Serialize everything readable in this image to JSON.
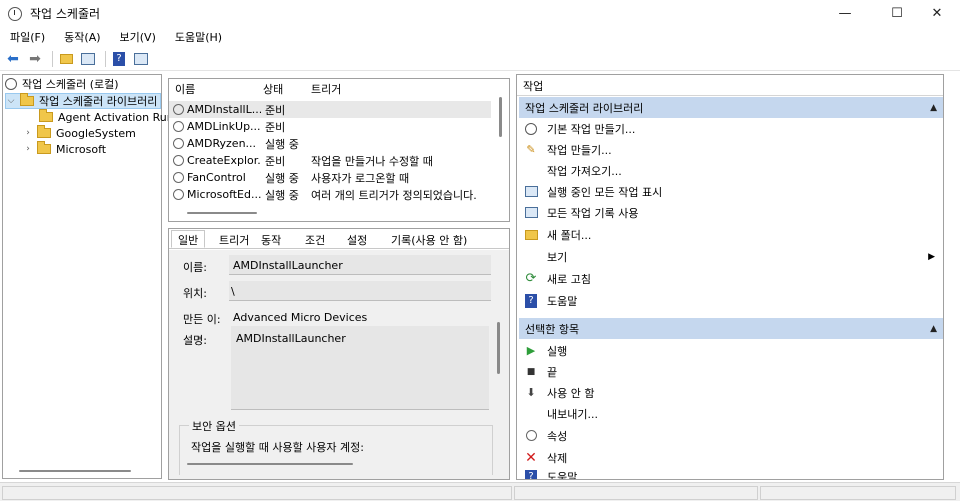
{
  "window": {
    "title": "작업 스케줄러"
  },
  "menu": [
    "파일(F)",
    "동작(A)",
    "보기(V)",
    "도움말(H)"
  ],
  "tree": {
    "root": "작업 스케줄러 (로컬)",
    "library": "작업 스케줄러 라이브러리",
    "children": [
      "Agent Activation Runtime",
      "GoogleSystem",
      "Microsoft"
    ]
  },
  "list": {
    "columns": [
      "이름",
      "상태",
      "트리거"
    ],
    "rows": [
      {
        "name": "AMDInstallL...",
        "status": "준비",
        "trigger": ""
      },
      {
        "name": "AMDLinkUp...",
        "status": "준비",
        "trigger": ""
      },
      {
        "name": "AMDRyzen...",
        "status": "실행 중",
        "trigger": ""
      },
      {
        "name": "CreateExplor...",
        "status": "준비",
        "trigger": "작업을 만들거나 수정할 때"
      },
      {
        "name": "FanControl",
        "status": "실행 중",
        "trigger": "사용자가 로그온할 때"
      },
      {
        "name": "MicrosoftEd...",
        "status": "실행 중",
        "trigger": "여러 개의 트리거가 정의되었습니다."
      }
    ]
  },
  "detail": {
    "tabs": [
      "일반",
      "트리거",
      "동작",
      "조건",
      "설정",
      "기록(사용 안 함)"
    ],
    "name_label": "이름:",
    "name_value": "AMDInstallLauncher",
    "location_label": "위치:",
    "location_value": "\\",
    "author_label": "만든 이:",
    "author_value": "Advanced Micro Devices",
    "desc_label": "설명:",
    "desc_value": "AMDInstallLauncher",
    "security_label": "보안 옵션",
    "security_text": "작업을 실행할 때 사용할 사용자 계정:"
  },
  "actions": {
    "header": "작업",
    "section1": "작업 스케줄러 라이브러리",
    "items1": [
      "기본 작업 만들기...",
      "작업 만들기...",
      "작업 가져오기...",
      "실행 중인 모든 작업 표시",
      "모든 작업 기록 사용",
      "새 폴더...",
      "보기",
      "새로 고침",
      "도움말"
    ],
    "section2": "선택한 항목",
    "items2": [
      "실행",
      "끝",
      "사용 안 함",
      "내보내기...",
      "속성",
      "삭제",
      "도움말"
    ]
  },
  "colors": {
    "section_bg": "#c5d7ee",
    "selected_bg": "#cce4f7"
  }
}
